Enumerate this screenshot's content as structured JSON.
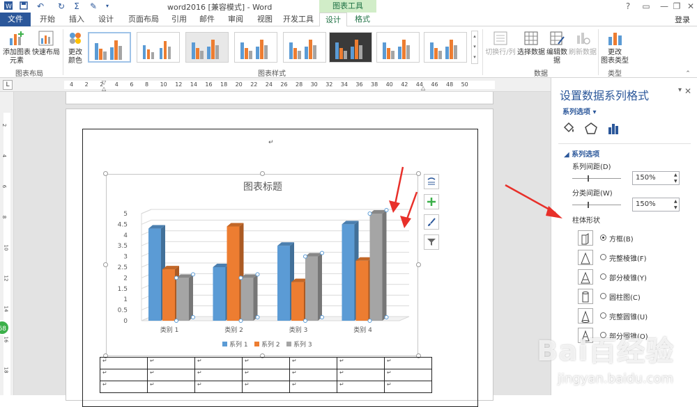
{
  "titlebar": {
    "doc_title": "word2016 [兼容模式] - Word",
    "chart_tools": "图表工具",
    "qat_icons": [
      "word-icon",
      "save-icon",
      "undo-icon",
      "redo-icon",
      "format-icon"
    ]
  },
  "tabs": [
    "文件",
    "开始",
    "插入",
    "设计",
    "页面布局",
    "引用",
    "邮件",
    "审阅",
    "视图",
    "开发工具",
    "设计",
    "格式"
  ],
  "login": "登录",
  "ribbon": {
    "add_element_1": "添加图表",
    "add_element_2": "元素",
    "quick_layout": "快速布局",
    "group_layout": "图表布局",
    "change_colors_1": "更改",
    "change_colors_2": "颜色",
    "group_styles": "图表样式",
    "switch_rowcol": "切换行/列",
    "select_data": "选择数据",
    "edit_data_1": "编辑数",
    "edit_data_2": "据",
    "refresh_data": "刷新数据",
    "group_data": "数据",
    "change_type_1": "更改",
    "change_type_2": "图表类型",
    "group_type": "类型"
  },
  "ruler": {
    "numbers": [
      "4",
      "2",
      "2",
      "4",
      "6",
      "8",
      "10",
      "12",
      "14",
      "16",
      "18",
      "20",
      "22",
      "24",
      "26",
      "28",
      "30",
      "32",
      "34",
      "36",
      "38",
      "40",
      "42",
      "44",
      "46",
      "48",
      "50"
    ],
    "corner": "L",
    "vnumbers": [
      "2",
      "4",
      "6",
      "8",
      "10",
      "12",
      "14",
      "16",
      "18"
    ]
  },
  "document": {
    "para_mark": "↵",
    "table_rows": 3,
    "table_cols": 7
  },
  "chart_data": {
    "type": "bar",
    "title": "图表标题",
    "categories": [
      "类别 1",
      "类别 2",
      "类别 3",
      "类别 4"
    ],
    "series": [
      {
        "name": "系列 1",
        "values": [
          4.3,
          2.5,
          3.5,
          4.5
        ],
        "color": "#5b9bd5"
      },
      {
        "name": "系列 2",
        "values": [
          2.4,
          4.4,
          1.8,
          2.8
        ],
        "color": "#ed7d31"
      },
      {
        "name": "系列 3",
        "values": [
          2.0,
          2.0,
          3.0,
          5.0
        ],
        "color": "#a5a5a5"
      }
    ],
    "ylim": [
      0,
      5
    ],
    "yticks": [
      "0",
      "0.5",
      "1",
      "1.5",
      "2",
      "2.5",
      "3",
      "3.5",
      "4",
      "4.5",
      "5"
    ],
    "grid": true,
    "legend": "bottom",
    "style": "3d-clustered-column"
  },
  "pane": {
    "title": "设置数据系列格式",
    "series_options_dd": "系列选项",
    "section": "系列选项",
    "gap_depth_label": "系列间距(D)",
    "gap_depth_value": "150%",
    "gap_width_label": "分类间距(W)",
    "gap_width_value": "150%",
    "shape_head": "柱体形状",
    "shapes": [
      "方框(B)",
      "完整棱锥(F)",
      "部分棱锥(Y)",
      "圆柱图(C)",
      "完整圆锥(U)",
      "部分圆锥(O)"
    ],
    "selected_shape": 0
  },
  "watermark": {
    "logo": "Bai百经验",
    "url": "jingyan.baidu.com"
  },
  "badge": "68",
  "annotation_color": "#e8302a"
}
